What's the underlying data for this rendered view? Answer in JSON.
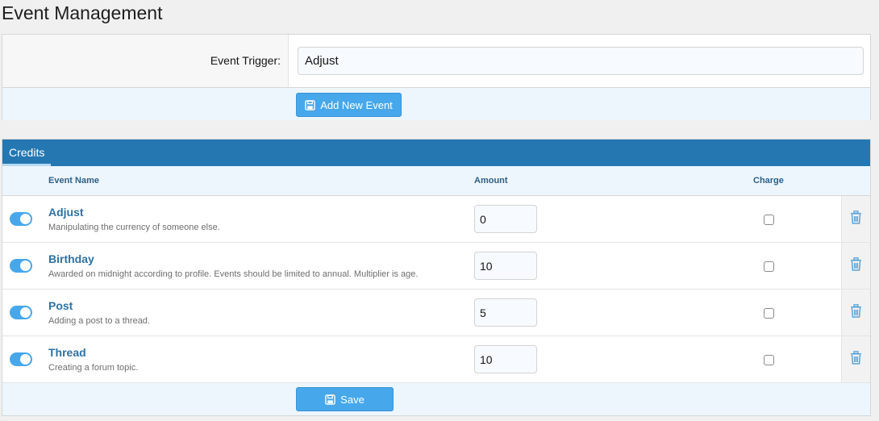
{
  "page": {
    "title": "Event Management"
  },
  "form": {
    "trigger_label": "Event Trigger:",
    "trigger_value": "Adjust",
    "add_button_label": "Add New Event"
  },
  "credits": {
    "tab_label": "Credits",
    "columns": {
      "name": "Event Name",
      "amount": "Amount",
      "charge": "Charge"
    },
    "events": [
      {
        "name": "Adjust",
        "description": "Manipulating the currency of someone else.",
        "amount": "0",
        "enabled": true,
        "charge": false
      },
      {
        "name": "Birthday",
        "description": "Awarded on midnight according to profile. Events should be limited to annual. Multiplier is age.",
        "amount": "10",
        "enabled": true,
        "charge": false
      },
      {
        "name": "Post",
        "description": "Adding a post to a thread.",
        "amount": "5",
        "enabled": true,
        "charge": false
      },
      {
        "name": "Thread",
        "description": "Creating a forum topic.",
        "amount": "10",
        "enabled": true,
        "charge": false
      }
    ],
    "save_button_label": "Save"
  },
  "colors": {
    "accent": "#47a7eb",
    "header_bar": "#2577b1",
    "link": "#2d72a3",
    "row_header_bg": "#edf6fd"
  },
  "icons": {
    "button_icon": "save-icon",
    "row_delete_icon": "trash-icon"
  }
}
